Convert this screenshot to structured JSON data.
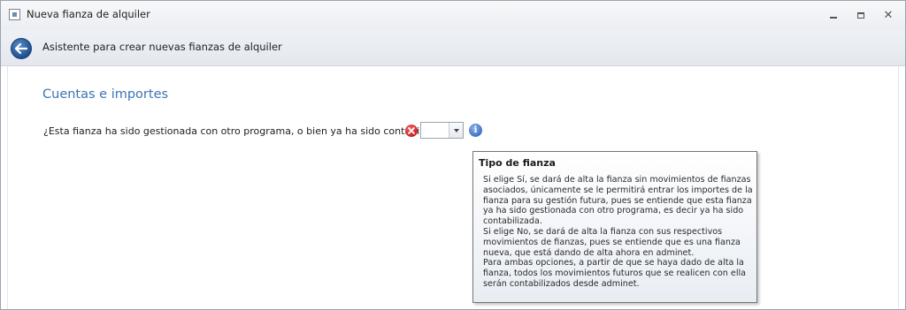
{
  "window": {
    "title": "Nueva fianza de alquiler",
    "controls": {
      "minimize": "minimize-icon",
      "maximize": "maximize-icon",
      "close": "close-icon"
    }
  },
  "header": {
    "back_icon": "back-arrow-icon",
    "title": "Asistente para crear nuevas fianzas de alquiler"
  },
  "section": {
    "title": "Cuentas e importes"
  },
  "question": {
    "label": "¿Esta fianza ha sido gestionada con otro programa, o bien ya ha sido contabilizada?",
    "value": "",
    "error_icon": "error-icon",
    "info_icon": "info-icon"
  },
  "tooltip": {
    "title": "Tipo de fianza",
    "lines": [
      "Si elige Sí, se dará de alta la fianza sin movimientos de fianzas",
      "asociados, únicamente se le permitirá entrar los importes de la",
      "fianza para su gestión futura, pues se entiende que esta fianza",
      "ya ha sido gestionada con otro programa, es decir ya ha sido",
      "contabilizada.",
      "Si elige No, se dará de alta la fianza con sus respectivos",
      "movimientos de fianzas, pues se entiende que es una fianza",
      "nueva, que está dando de alta ahora en adminet.",
      "Para ambas opciones, a partir de que se haya dado de alta la",
      "fianza, todos los movimientos futuros que se realicen con ella",
      "serán contabilizados desde adminet."
    ]
  },
  "colors": {
    "accent": "#3b74b5",
    "error": "#c81d1d",
    "info": "#3f72c2"
  }
}
